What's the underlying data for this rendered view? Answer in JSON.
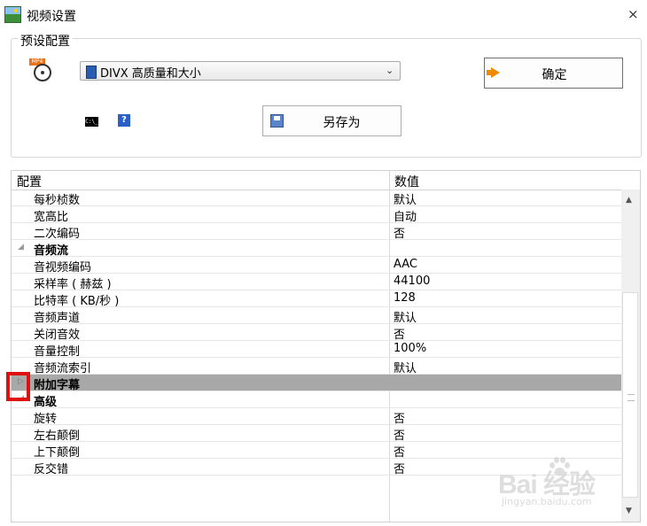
{
  "window": {
    "title": "视频设置",
    "close_glyph": "×"
  },
  "preset": {
    "legend": "预设配置",
    "selected": "DIVX 高质量和大小",
    "ok_button": "确定",
    "save_as_button": "另存为",
    "file_icon_tag": "MP4",
    "cmd_icon_text": "C:\\_",
    "help_icon_text": "?"
  },
  "grid": {
    "col_name": "配置",
    "col_value": "数值",
    "rows": [
      {
        "name": "每秒桢数",
        "value": "默认",
        "type": "item"
      },
      {
        "name": "宽高比",
        "value": "自动",
        "type": "item"
      },
      {
        "name": "二次编码",
        "value": "否",
        "type": "item"
      },
      {
        "name": "音频流",
        "value": "",
        "type": "category",
        "expanded": true
      },
      {
        "name": "音视频编码",
        "value": "AAC",
        "type": "item"
      },
      {
        "name": "采样率 ( 赫兹 )",
        "value": "44100",
        "type": "item"
      },
      {
        "name": "比特率 ( KB/秒 )",
        "value": "128",
        "type": "item"
      },
      {
        "name": "音频声道",
        "value": "默认",
        "type": "item"
      },
      {
        "name": "关闭音效",
        "value": "否",
        "type": "item"
      },
      {
        "name": "音量控制",
        "value": "100%",
        "type": "item"
      },
      {
        "name": "音频流索引",
        "value": "默认",
        "type": "item"
      },
      {
        "name": "附加字幕",
        "value": "",
        "type": "category",
        "expanded": false,
        "selected": true
      },
      {
        "name": "高级",
        "value": "",
        "type": "category",
        "expanded": true
      },
      {
        "name": "旋转",
        "value": "否",
        "type": "item"
      },
      {
        "name": "左右颠倒",
        "value": "否",
        "type": "item"
      },
      {
        "name": "上下颠倒",
        "value": "否",
        "type": "item"
      },
      {
        "name": "反交错",
        "value": "否",
        "type": "item"
      }
    ]
  },
  "watermark": {
    "main": "Bai  经验",
    "sub": "jingyan.baidu.com"
  },
  "colors": {
    "selected_row": "#a8a8a8",
    "highlight_box": "#e01010",
    "ok_arrow": "#f08a00"
  }
}
